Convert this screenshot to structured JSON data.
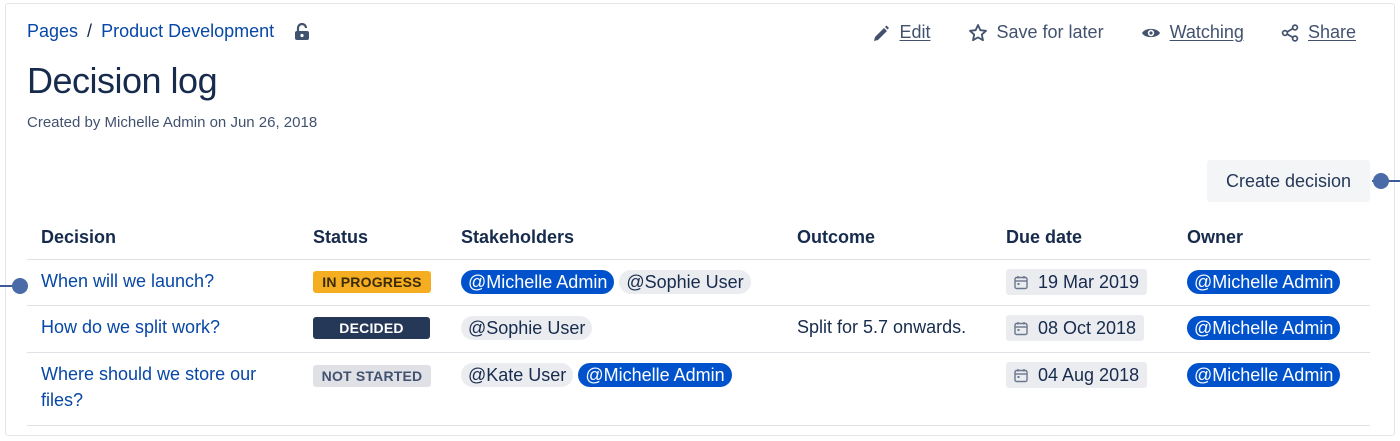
{
  "breadcrumb": {
    "root": "Pages",
    "separator": "/",
    "space": "Product Development",
    "lock_icon": "unlock-icon"
  },
  "actions": {
    "edit": "Edit",
    "save_for_later": "Save for later",
    "watching": "Watching",
    "share": "Share"
  },
  "page": {
    "title": "Decision log",
    "byline": "Created by Michelle Admin on Jun 26, 2018"
  },
  "create_decision_label": "Create decision",
  "table": {
    "headers": {
      "decision": "Decision",
      "status": "Status",
      "stakeholders": "Stakeholders",
      "outcome": "Outcome",
      "due_date": "Due date",
      "owner": "Owner"
    },
    "rows": [
      {
        "decision": "When will we launch?",
        "status": "IN PROGRESS",
        "stakeholders": [
          "@Michelle Admin",
          "@Sophie User"
        ],
        "outcome": "",
        "due_date": "19 Mar 2019",
        "owner": "@Michelle Admin"
      },
      {
        "decision": "How do we split work?",
        "status": "DECIDED",
        "stakeholders": [
          "@Sophie User"
        ],
        "outcome": "Split for 5.7 onwards.",
        "due_date": "08 Oct 2018",
        "owner": "@Michelle Admin"
      },
      {
        "decision": "Where should we store our files?",
        "status": "NOT STARTED",
        "stakeholders": [
          "@Kate User",
          "@Michelle Admin"
        ],
        "outcome": "",
        "due_date": "04 Aug 2018",
        "owner": "@Michelle Admin"
      }
    ]
  },
  "colors": {
    "link": "#0747a6",
    "mention_blue": "#0052cc",
    "in_progress": "#f5ad21",
    "decided": "#253858",
    "not_started": "#dfe1e6"
  }
}
